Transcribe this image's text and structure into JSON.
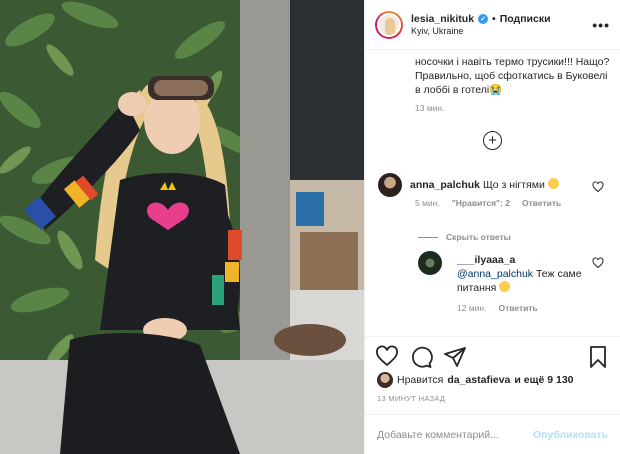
{
  "header": {
    "username": "lesia_nikituk",
    "follow_label": "Подписки",
    "separator": "•",
    "location": "Kyiv, Ukraine",
    "more": "•••"
  },
  "caption": {
    "text": "носочки і навіть термо трусики!!! Нащо? Правильно, щоб сфоткатись в Буковелі в лоббі в готелі😭",
    "time": "13 мин."
  },
  "comments": [
    {
      "username": "anna_palchuk",
      "text": " Що з нігтями ",
      "time": "5 мин.",
      "likes": "\"Нравится\": 2",
      "reply": "Ответить"
    }
  ],
  "hide_replies": "Скрыть ответы",
  "replies": [
    {
      "username": "___ilyaaa_a",
      "mention": "@anna_palchuk",
      "text": " Теж саме питання ",
      "time": "12 мин.",
      "reply": "Ответить"
    }
  ],
  "likes": {
    "prefix": "Нравится",
    "user": "da_astafieva",
    "suffix": "и ещё 9 130"
  },
  "timestamp": "13 минут назад",
  "add_comment": {
    "placeholder": "Добавьте комментарий...",
    "publish": "Опубликовать"
  },
  "colors": {
    "link": "#00376b",
    "verified": "#3897f0",
    "publish_disabled": "#b2dffc",
    "muted": "#8e8e8e"
  }
}
